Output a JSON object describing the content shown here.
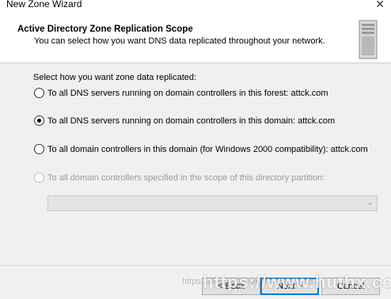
{
  "window": {
    "title": "New Zone Wizard",
    "close_glyph": "✕"
  },
  "header": {
    "title": "Active Directory Zone Replication Scope",
    "subtitle": "You can select how you want DNS data replicated throughout your network.",
    "icon": "server-icon"
  },
  "main": {
    "prompt": "Select how you want zone data replicated:",
    "options": [
      {
        "label": "To all DNS servers running on domain controllers in this forest: attck.com",
        "checked": false,
        "disabled": false
      },
      {
        "label": "To all DNS servers running on domain controllers in this domain: attck.com",
        "checked": true,
        "disabled": false
      },
      {
        "label": "To all domain controllers in this domain (for Windows 2000 compatibility): attck.com",
        "checked": false,
        "disabled": false
      },
      {
        "label": "To all domain controllers specified in the scope of this directory partition:",
        "checked": false,
        "disabled": true
      }
    ],
    "partition_combo": {
      "value": "",
      "disabled": true
    }
  },
  "footer": {
    "back_label": "< Back",
    "next_label": "Next >",
    "cancel_label": "Cancel"
  },
  "watermark": {
    "text": "https://www.huthx.cc",
    "faint_text": "https://blog.csdn.net/m0_64910183"
  }
}
